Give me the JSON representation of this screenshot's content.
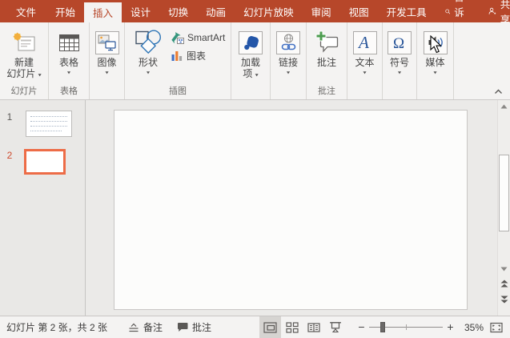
{
  "colors": {
    "brand_red": "#B7472A",
    "selection_orange": "#ED6C47",
    "office_blue": "#2B579A",
    "ribbon_bg": "#F4F3F2"
  },
  "tabbar": {
    "tabs": [
      "文件",
      "开始",
      "插入",
      "设计",
      "切换",
      "动画",
      "幻灯片放映",
      "审阅",
      "视图",
      "开发工具"
    ],
    "selected_tab": "插入",
    "tell_me_label": "告诉我",
    "share_label": "共享"
  },
  "ribbon": {
    "new_slide": {
      "label_line1": "新建",
      "label_line2": "幻灯片"
    },
    "table": {
      "label": "表格"
    },
    "images": {
      "label": "图像"
    },
    "shapes": {
      "label": "形状"
    },
    "smartart": {
      "label": "SmartArt"
    },
    "chart": {
      "label": "图表"
    },
    "addins": {
      "label_line1": "加载",
      "label_line2": "项"
    },
    "links": {
      "label": "链接"
    },
    "comment": {
      "label": "批注"
    },
    "text": {
      "label": "文本"
    },
    "symbols": {
      "label": "符号"
    },
    "media": {
      "label": "媒体"
    },
    "group_labels": {
      "slides": "幻灯片",
      "tables": "表格",
      "illustrations": "插图",
      "comments": "批注"
    }
  },
  "slide_panel": {
    "slides": [
      {
        "number": "1",
        "selected": false
      },
      {
        "number": "2",
        "selected": true
      }
    ]
  },
  "statusbar": {
    "slide_counter": "幻灯片 第 2 张，共 2 张",
    "notes_label": "备注",
    "comments_label": "批注",
    "zoom_level": "35%"
  },
  "icons": {
    "caret": "▾",
    "zoom_out": "−",
    "zoom_in": "+"
  }
}
